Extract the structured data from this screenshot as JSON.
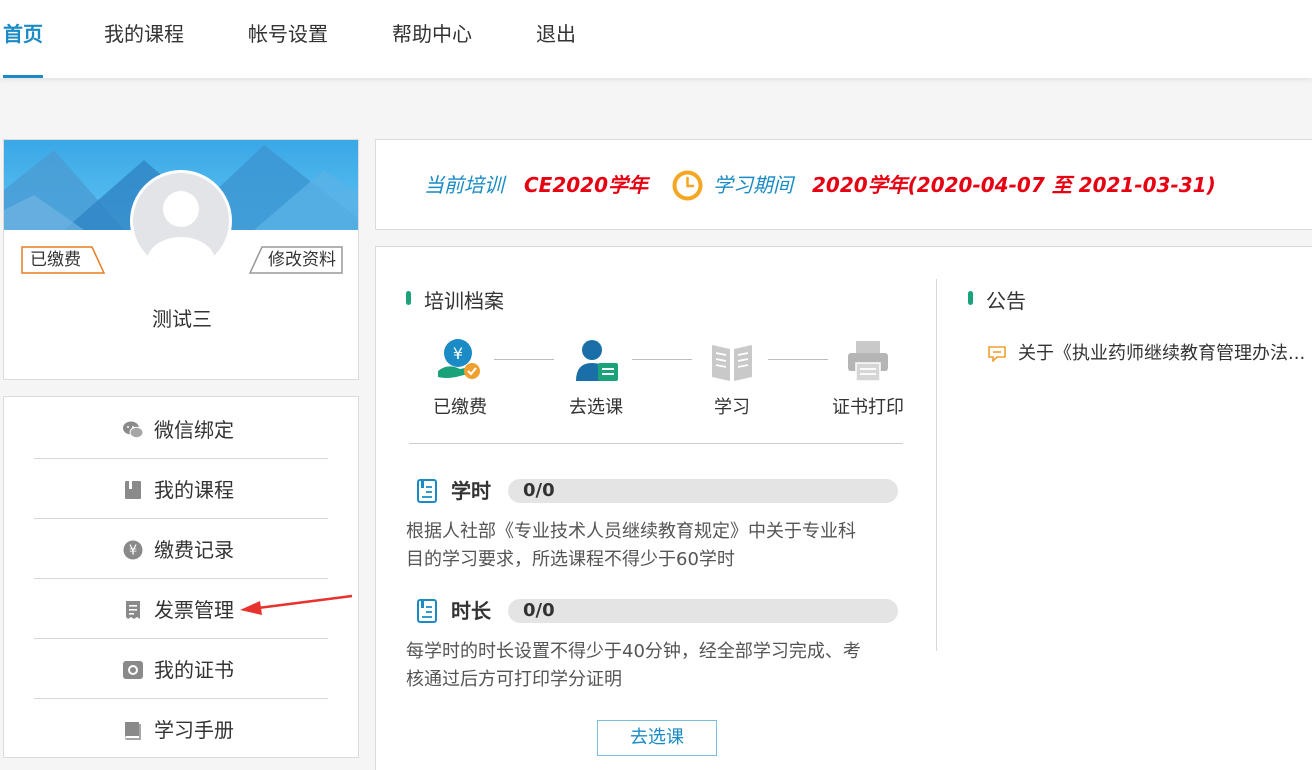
{
  "nav": {
    "items": [
      {
        "label": "首页",
        "active": true
      },
      {
        "label": "我的课程",
        "active": false
      },
      {
        "label": "帐号设置",
        "active": false
      },
      {
        "label": "帮助中心",
        "active": false
      },
      {
        "label": "退出",
        "active": false
      }
    ]
  },
  "profile": {
    "name": "测试三",
    "paid_badge": "已缴费",
    "edit_label": "修改资料"
  },
  "menu": {
    "items": [
      {
        "label": "微信绑定",
        "icon": "wechat-icon"
      },
      {
        "label": "我的课程",
        "icon": "book-icon"
      },
      {
        "label": "缴费记录",
        "icon": "yen-icon"
      },
      {
        "label": "发票管理",
        "icon": "invoice-icon"
      },
      {
        "label": "我的证书",
        "icon": "certificate-icon"
      },
      {
        "label": "学习手册",
        "icon": "manual-icon"
      }
    ]
  },
  "training": {
    "current_label": "当前培训",
    "current_value": "CE2020学年",
    "period_label": "学习期间",
    "period_value": "2020学年(2020-04-07 至 2021-03-31)"
  },
  "archive": {
    "title": "培训档案",
    "steps": [
      {
        "label": "已缴费",
        "icon": "paid-icon",
        "done": true
      },
      {
        "label": "去选课",
        "icon": "select-course-icon",
        "done": true
      },
      {
        "label": "学习",
        "icon": "study-icon",
        "done": false
      },
      {
        "label": "证书打印",
        "icon": "print-icon",
        "done": false
      }
    ],
    "hours": {
      "title": "学时",
      "value": "0/0",
      "desc_line1": "根据人社部《专业技术人员继续教育规定》中关于专业科",
      "desc_line2": "目的学习要求，所选课程不得少于60学时"
    },
    "duration": {
      "title": "时长",
      "value": "0/0",
      "desc_line1": "每学时的时长设置不得少于40分钟，经全部学习完成、考",
      "desc_line2": "核通过后方可打印学分证明"
    },
    "select_button": "去选课"
  },
  "notice": {
    "title": "公告",
    "items": [
      {
        "text": "关于《执业药师继续教育管理办法..."
      }
    ]
  },
  "colors": {
    "accent": "#1a8bc4",
    "highlight": "#e60012",
    "green": "#1aa37a",
    "orange": "#f0a030"
  }
}
